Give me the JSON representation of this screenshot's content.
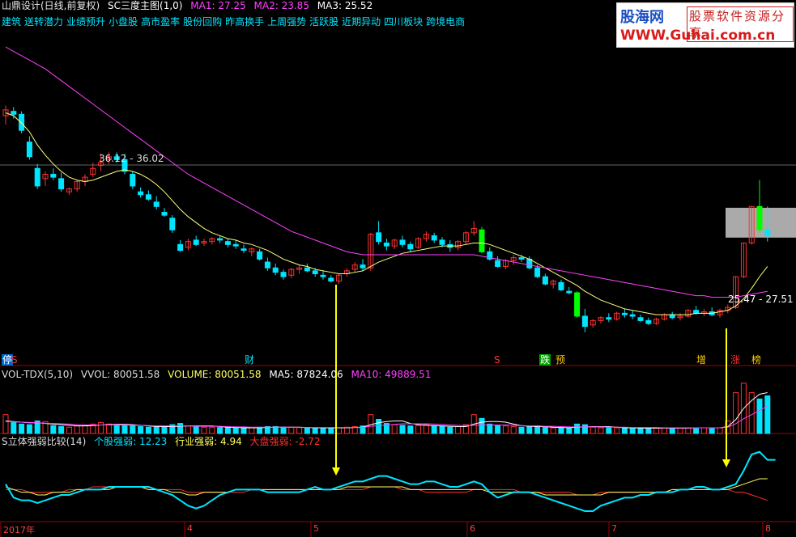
{
  "header": {
    "stock": "山鼎设计(日线,前复权)",
    "indicator": "SC三度主图(1,0)",
    "ma1": "MA1: 27.25",
    "ma2": "MA2: 23.85",
    "ma3": "MA3: 25.52"
  },
  "tags": [
    "建筑",
    "送转潜力",
    "业绩预升",
    "小盘股",
    "高市盈率",
    "股份回购",
    "昨高换手",
    "上周强势",
    "活跃股",
    "近期异动",
    "四川板块",
    "跨境电商"
  ],
  "logo": {
    "line1_cn": "股海网",
    "line1_box": "股票软件资源分享",
    "line2": "WWW.Guhai.com.cn"
  },
  "price_panel": {
    "annotation_high": "36.12 - 36.02",
    "annotation_band": "25.47 - 27.51",
    "markers": [
      {
        "text": "停",
        "color": "#ffffff",
        "bg": "#0066cc"
      },
      {
        "text": "S",
        "color": "#ff3030"
      },
      {
        "text": "财",
        "color": "#00e5ff"
      },
      {
        "text": "S",
        "color": "#ff3030"
      },
      {
        "text": "跌",
        "color": "#ffffff",
        "bg": "#00a000"
      },
      {
        "text": "预",
        "color": "#ffcc00"
      },
      {
        "text": "增",
        "color": "#ffcc00"
      },
      {
        "text": "涨",
        "color": "#ff3030"
      },
      {
        "text": "榜",
        "color": "#ffcc00"
      }
    ]
  },
  "volume_panel": {
    "title": "VOL-TDX(5,10)",
    "vvol": "VVOL: 80051.58",
    "volume": "VOLUME: 80051.58",
    "ma5": "MA5: 87824.06",
    "ma10": "MA10: 49889.51"
  },
  "strength_panel": {
    "title": "S立体强弱比较(14)",
    "stock": "个股强弱: 12.23",
    "industry": "行业强弱: 4.94",
    "market": "大盘强弱: -2.72"
  },
  "time_axis": {
    "labels": [
      "2017年",
      "4",
      "5",
      "6",
      "7",
      "8"
    ]
  },
  "colors": {
    "up": "#ff3030",
    "down": "#00e5ff",
    "limit_down": "#00ff00",
    "ma_short": "#ffff80",
    "ma_long": "#ff40ff",
    "arrow": "#ffff00",
    "band": "#c8c8c8"
  },
  "chart_data": {
    "type": "candlestick",
    "ohlc": [
      [
        33.8,
        34.5,
        33.2,
        34.2
      ],
      [
        34.1,
        34.4,
        33.6,
        33.9
      ],
      [
        33.9,
        34.1,
        32.6,
        32.8
      ],
      [
        32.0,
        32.4,
        30.8,
        31.0
      ],
      [
        30.2,
        30.5,
        28.8,
        29.0
      ],
      [
        29.5,
        30.0,
        29.0,
        29.8
      ],
      [
        29.8,
        30.2,
        29.4,
        29.6
      ],
      [
        29.5,
        29.9,
        28.6,
        28.8
      ],
      [
        28.6,
        28.9,
        28.4,
        28.8
      ],
      [
        28.8,
        29.4,
        28.6,
        29.3
      ],
      [
        29.3,
        29.8,
        29.0,
        29.6
      ],
      [
        29.8,
        30.6,
        29.6,
        30.2
      ],
      [
        30.4,
        31.2,
        30.0,
        30.6
      ],
      [
        30.8,
        31.3,
        30.5,
        31.0
      ],
      [
        31.0,
        31.3,
        30.6,
        30.8
      ],
      [
        30.8,
        31.2,
        29.8,
        30.0
      ],
      [
        29.8,
        30.0,
        28.8,
        29.0
      ],
      [
        28.6,
        28.9,
        28.2,
        28.4
      ],
      [
        28.4,
        28.7,
        28.0,
        28.1
      ],
      [
        27.9,
        28.3,
        27.4,
        27.6
      ],
      [
        27.2,
        27.5,
        26.9,
        27.0
      ],
      [
        26.8,
        27.0,
        25.8,
        26.0
      ],
      [
        25.0,
        25.3,
        24.5,
        24.6
      ],
      [
        24.8,
        25.4,
        24.6,
        25.2
      ],
      [
        25.3,
        25.6,
        24.9,
        25.0
      ],
      [
        25.1,
        25.4,
        24.9,
        25.2
      ],
      [
        25.2,
        25.5,
        25.0,
        25.4
      ],
      [
        25.4,
        25.6,
        25.1,
        25.3
      ],
      [
        25.2,
        25.4,
        24.8,
        25.0
      ],
      [
        25.0,
        25.3,
        24.7,
        24.9
      ],
      [
        24.7,
        25.0,
        24.4,
        24.6
      ],
      [
        24.5,
        24.8,
        24.2,
        24.7
      ],
      [
        24.5,
        24.7,
        23.9,
        24.0
      ],
      [
        23.8,
        24.1,
        23.2,
        23.4
      ],
      [
        23.4,
        23.7,
        22.9,
        23.1
      ],
      [
        23.1,
        23.3,
        22.6,
        22.8
      ],
      [
        22.9,
        23.4,
        22.7,
        23.3
      ],
      [
        23.3,
        23.6,
        23.0,
        23.4
      ],
      [
        23.4,
        23.7,
        23.1,
        23.2
      ],
      [
        23.2,
        23.4,
        22.8,
        23.0
      ],
      [
        22.9,
        23.2,
        22.6,
        22.8
      ],
      [
        22.7,
        22.9,
        22.4,
        22.5
      ],
      [
        22.5,
        23.0,
        22.3,
        22.9
      ],
      [
        23.0,
        23.4,
        22.8,
        23.2
      ],
      [
        23.3,
        23.8,
        23.1,
        23.6
      ],
      [
        23.6,
        24.0,
        23.2,
        23.4
      ],
      [
        23.4,
        25.8,
        23.2,
        25.7
      ],
      [
        25.8,
        26.6,
        25.0,
        25.2
      ],
      [
        25.1,
        25.4,
        24.6,
        24.9
      ],
      [
        24.9,
        25.4,
        24.7,
        25.3
      ],
      [
        25.3,
        25.6,
        24.8,
        25.0
      ],
      [
        25.0,
        25.2,
        24.5,
        24.7
      ],
      [
        24.8,
        25.5,
        24.7,
        25.4
      ],
      [
        25.4,
        25.9,
        25.2,
        25.7
      ],
      [
        25.6,
        25.8,
        25.1,
        25.3
      ],
      [
        25.3,
        25.5,
        24.8,
        25.0
      ],
      [
        25.0,
        25.3,
        24.5,
        24.8
      ],
      [
        24.8,
        25.3,
        24.6,
        25.2
      ],
      [
        25.2,
        25.9,
        25.0,
        25.8
      ],
      [
        25.8,
        26.6,
        25.6,
        26.1
      ],
      [
        26.0,
        26.2,
        24.4,
        24.5
      ],
      [
        24.5,
        24.8,
        23.9,
        24.0
      ],
      [
        23.9,
        24.2,
        23.4,
        23.5
      ],
      [
        23.5,
        24.0,
        23.3,
        23.9
      ],
      [
        23.9,
        24.3,
        23.6,
        24.1
      ],
      [
        24.1,
        24.3,
        23.8,
        24.0
      ],
      [
        24.0,
        24.2,
        23.3,
        23.4
      ],
      [
        23.4,
        23.6,
        22.7,
        22.8
      ],
      [
        22.8,
        23.0,
        22.2,
        22.3
      ],
      [
        22.3,
        22.6,
        22.0,
        22.5
      ],
      [
        22.4,
        22.6,
        21.8,
        21.9
      ],
      [
        21.8,
        22.1,
        21.6,
        21.7
      ],
      [
        21.7,
        21.8,
        20.0,
        20.1
      ],
      [
        20.1,
        20.6,
        19.0,
        19.4
      ],
      [
        19.5,
        19.9,
        19.3,
        19.8
      ],
      [
        19.8,
        20.1,
        19.6,
        20.0
      ],
      [
        20.0,
        20.3,
        19.7,
        19.9
      ],
      [
        19.9,
        20.4,
        19.8,
        20.3
      ],
      [
        20.3,
        20.6,
        20.0,
        20.2
      ],
      [
        20.2,
        20.5,
        19.9,
        20.1
      ],
      [
        20.0,
        20.2,
        19.7,
        19.8
      ],
      [
        19.8,
        20.0,
        19.5,
        19.6
      ],
      [
        19.6,
        20.0,
        19.5,
        19.9
      ],
      [
        19.9,
        20.3,
        19.8,
        20.2
      ],
      [
        20.2,
        20.4,
        19.9,
        20.0
      ],
      [
        20.0,
        20.3,
        19.8,
        20.1
      ],
      [
        20.1,
        20.6,
        20.0,
        20.5
      ],
      [
        20.5,
        20.8,
        20.2,
        20.3
      ],
      [
        20.3,
        20.6,
        20.1,
        20.4
      ],
      [
        20.4,
        20.7,
        20.1,
        20.2
      ],
      [
        20.2,
        20.6,
        20.0,
        20.5
      ],
      [
        20.5,
        20.9,
        20.3,
        20.7
      ],
      [
        20.7,
        22.8,
        20.6,
        22.8
      ],
      [
        22.8,
        25.1,
        22.7,
        25.1
      ],
      [
        25.1,
        27.6,
        25.0,
        27.6
      ],
      [
        27.6,
        29.4,
        25.8,
        26.0
      ],
      [
        26.0,
        27.6,
        25.2,
        25.6
      ]
    ],
    "ma_short": [
      34.0,
      33.8,
      33.3,
      32.7,
      31.8,
      31.1,
      30.5,
      30.0,
      29.6,
      29.4,
      29.3,
      29.4,
      29.6,
      29.8,
      30.0,
      30.1,
      30.0,
      29.8,
      29.5,
      29.1,
      28.6,
      28.0,
      27.4,
      26.9,
      26.5,
      26.1,
      25.8,
      25.6,
      25.4,
      25.3,
      25.1,
      25.0,
      24.8,
      24.6,
      24.3,
      24.0,
      23.8,
      23.6,
      23.5,
      23.3,
      23.2,
      23.1,
      23.0,
      23.0,
      23.1,
      23.2,
      23.5,
      23.8,
      24.0,
      24.2,
      24.4,
      24.5,
      24.6,
      24.7,
      24.8,
      24.9,
      24.9,
      24.9,
      25.0,
      25.1,
      25.1,
      25.0,
      24.8,
      24.6,
      24.4,
      24.2,
      24.0,
      23.7,
      23.4,
      23.1,
      22.8,
      22.5,
      22.2,
      21.8,
      21.5,
      21.2,
      21.0,
      20.8,
      20.6,
      20.5,
      20.4,
      20.3,
      20.2,
      20.2,
      20.2,
      20.2,
      20.2,
      20.3,
      20.3,
      20.3,
      20.4,
      20.5,
      20.8,
      21.3,
      22.0,
      22.8,
      23.5
    ],
    "ma_long": [
      38.5,
      38.2,
      37.9,
      37.6,
      37.3,
      37.0,
      36.6,
      36.2,
      35.8,
      35.4,
      35.0,
      34.6,
      34.2,
      33.8,
      33.4,
      33.0,
      32.6,
      32.2,
      31.8,
      31.4,
      31.0,
      30.6,
      30.2,
      29.8,
      29.5,
      29.2,
      28.9,
      28.6,
      28.3,
      28.0,
      27.7,
      27.4,
      27.1,
      26.8,
      26.5,
      26.2,
      25.9,
      25.7,
      25.5,
      25.3,
      25.1,
      24.9,
      24.7,
      24.5,
      24.4,
      24.3,
      24.3,
      24.3,
      24.3,
      24.3,
      24.3,
      24.3,
      24.3,
      24.3,
      24.3,
      24.3,
      24.3,
      24.3,
      24.3,
      24.3,
      24.2,
      24.1,
      24.0,
      23.9,
      23.8,
      23.7,
      23.6,
      23.5,
      23.4,
      23.3,
      23.2,
      23.1,
      23.0,
      22.9,
      22.8,
      22.7,
      22.6,
      22.5,
      22.4,
      22.3,
      22.2,
      22.1,
      22.0,
      21.9,
      21.8,
      21.7,
      21.6,
      21.5,
      21.5,
      21.4,
      21.4,
      21.4,
      21.4,
      21.5,
      21.6,
      21.7,
      21.8
    ],
    "volume": [
      60,
      35,
      30,
      28,
      40,
      38,
      25,
      22,
      20,
      24,
      26,
      30,
      35,
      30,
      28,
      26,
      24,
      22,
      20,
      20,
      22,
      28,
      32,
      24,
      22,
      20,
      20,
      19,
      18,
      18,
      18,
      18,
      20,
      22,
      22,
      20,
      20,
      19,
      18,
      18,
      18,
      17,
      18,
      20,
      22,
      24,
      60,
      45,
      32,
      28,
      26,
      24,
      26,
      28,
      24,
      22,
      20,
      22,
      28,
      60,
      48,
      30,
      26,
      24,
      22,
      20,
      22,
      24,
      20,
      18,
      18,
      16,
      30,
      28,
      20,
      18,
      18,
      18,
      18,
      17,
      16,
      16,
      17,
      18,
      18,
      17,
      18,
      18,
      18,
      18,
      18,
      40,
      130,
      160,
      130,
      110,
      120
    ],
    "vol_ma5": [
      40,
      38,
      36,
      34,
      34,
      32,
      30,
      28,
      26,
      24,
      24,
      25,
      27,
      28,
      29,
      29,
      28,
      26,
      24,
      22,
      22,
      22,
      23,
      24,
      24,
      24,
      24,
      22,
      20,
      19,
      18,
      18,
      18,
      19,
      20,
      20,
      20,
      20,
      19,
      18,
      18,
      18,
      18,
      18,
      19,
      20,
      28,
      34,
      38,
      40,
      40,
      32,
      28,
      26,
      25,
      24,
      23,
      22,
      22,
      30,
      36,
      38,
      38,
      36,
      30,
      25,
      23,
      22,
      22,
      20,
      19,
      18,
      20,
      21,
      22,
      22,
      22,
      20,
      18,
      18,
      17,
      17,
      17,
      17,
      17,
      17,
      17,
      18,
      18,
      18,
      18,
      22,
      44,
      80,
      105,
      125,
      130
    ],
    "vol_ma10": [
      38,
      37,
      36,
      35,
      34,
      33,
      32,
      31,
      30,
      28,
      27,
      27,
      27,
      27,
      27,
      27,
      26,
      26,
      25,
      24,
      24,
      24,
      24,
      24,
      23,
      23,
      23,
      23,
      22,
      21,
      21,
      20,
      20,
      20,
      20,
      20,
      20,
      19,
      19,
      19,
      19,
      19,
      19,
      19,
      19,
      19,
      23,
      25,
      27,
      29,
      31,
      31,
      31,
      31,
      30,
      29,
      27,
      26,
      25,
      26,
      27,
      27,
      27,
      27,
      26,
      25,
      24,
      24,
      23,
      23,
      22,
      21,
      21,
      21,
      21,
      21,
      20,
      20,
      20,
      19,
      19,
      19,
      19,
      18,
      18,
      18,
      18,
      18,
      18,
      18,
      18,
      20,
      31,
      47,
      60,
      74,
      87
    ],
    "strength_stock": [
      3,
      -2,
      -3,
      -3,
      -4,
      -3,
      -2,
      -1,
      -1,
      0,
      1,
      1,
      1,
      2,
      2,
      2,
      2,
      2,
      2,
      1,
      0,
      -1,
      -3,
      -5,
      -6,
      -5,
      -3,
      -1,
      0,
      1,
      1,
      1,
      1,
      0,
      0,
      0,
      0,
      0,
      1,
      2,
      1,
      1,
      2,
      3,
      4,
      4,
      5,
      6,
      6,
      5,
      4,
      3,
      3,
      4,
      4,
      3,
      2,
      2,
      3,
      4,
      3,
      0,
      -2,
      -1,
      0,
      0,
      0,
      -1,
      -2,
      -3,
      -4,
      -5,
      -6,
      -7,
      -7,
      -5,
      -4,
      -3,
      -2,
      -2,
      -1,
      -1,
      0,
      0,
      0,
      1,
      1,
      2,
      2,
      1,
      1,
      2,
      3,
      8,
      14,
      15,
      12,
      12
    ],
    "strength_industry": [
      2,
      1,
      0,
      0,
      -1,
      -1,
      0,
      0,
      0,
      1,
      1,
      1,
      1,
      1,
      2,
      2,
      2,
      2,
      1,
      1,
      1,
      0,
      0,
      -1,
      -1,
      0,
      0,
      0,
      0,
      1,
      1,
      1,
      1,
      1,
      1,
      1,
      1,
      1,
      1,
      1,
      1,
      1,
      1,
      2,
      2,
      2,
      2,
      2,
      2,
      2,
      2,
      1,
      1,
      1,
      1,
      1,
      1,
      1,
      1,
      1,
      1,
      0,
      0,
      0,
      0,
      0,
      0,
      0,
      -1,
      -1,
      -1,
      -1,
      -1,
      -1,
      -1,
      -1,
      0,
      0,
      0,
      0,
      0,
      0,
      0,
      0,
      1,
      1,
      1,
      1,
      1,
      1,
      1,
      1,
      2,
      3,
      4,
      5,
      5
    ],
    "strength_market": [
      1,
      1,
      1,
      0,
      0,
      0,
      0,
      0,
      1,
      1,
      1,
      2,
      2,
      2,
      2,
      2,
      2,
      2,
      1,
      1,
      1,
      1,
      1,
      0,
      0,
      0,
      0,
      0,
      0,
      0,
      0,
      1,
      1,
      1,
      1,
      1,
      1,
      1,
      1,
      1,
      1,
      1,
      1,
      1,
      1,
      1,
      2,
      2,
      2,
      2,
      1,
      1,
      1,
      0,
      0,
      0,
      0,
      0,
      0,
      1,
      1,
      1,
      1,
      1,
      1,
      0,
      0,
      0,
      0,
      0,
      0,
      0,
      -1,
      -1,
      -1,
      0,
      0,
      0,
      0,
      0,
      0,
      0,
      0,
      0,
      1,
      1,
      1,
      1,
      1,
      1,
      1,
      1,
      0,
      0,
      -1,
      -2,
      -3
    ],
    "price_range": [
      17.5,
      39.5
    ],
    "strength_range": [
      -10,
      17
    ],
    "band": [
      25.47,
      27.51
    ]
  }
}
